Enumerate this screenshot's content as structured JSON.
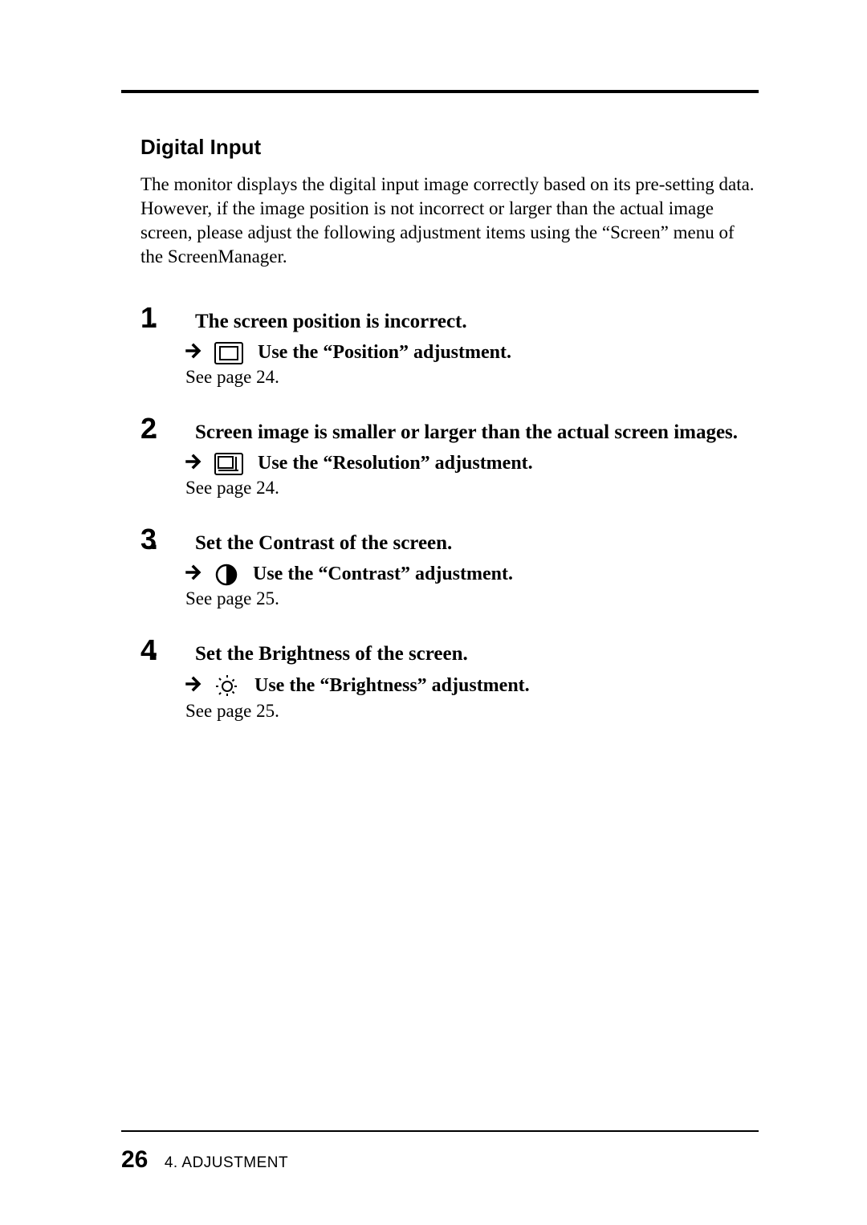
{
  "section_title": "Digital Input",
  "body_text": "The monitor displays the digital input image correctly based on its pre-setting data. However, if the image position is not incorrect or larger than the actual image screen, please adjust the following adjustment items using the “Screen” menu of the ScreenManager.",
  "steps": [
    {
      "num": "1",
      "title": "The screen position is incorrect.",
      "action": "Use the “Position” adjustment.",
      "see": "See page 24."
    },
    {
      "num": "2",
      "title": "Screen image is smaller or larger than the actual screen images.",
      "action": "Use the “Resolution” adjustment.",
      "see": "See page 24."
    },
    {
      "num": "3",
      "title": "Set the Contrast of the screen.",
      "action": "Use the “Contrast” adjustment.",
      "see": "See page 25."
    },
    {
      "num": "4",
      "title": "Set the Brightness of the screen.",
      "action": "Use the “Brightness” adjustment.",
      "see": "See page 25."
    }
  ],
  "footer": {
    "page_num": "26",
    "section": "4. ADJUSTMENT"
  }
}
